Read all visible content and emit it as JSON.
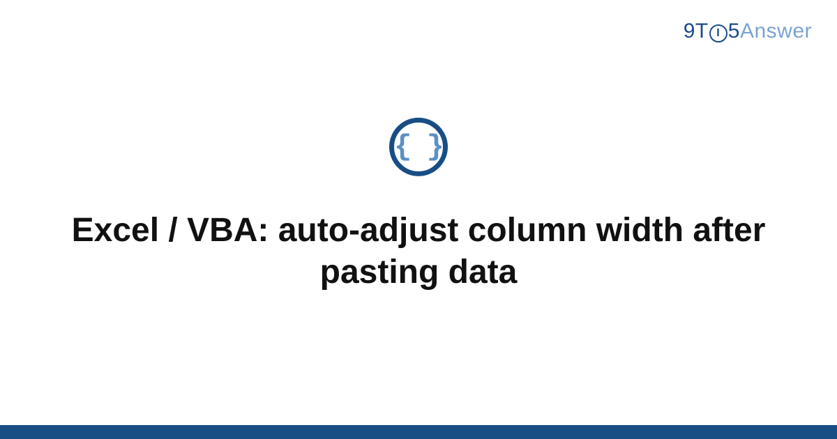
{
  "logo": {
    "part_9t": "9T",
    "part_o_inner": "I",
    "part_5": "5",
    "part_answer": "Answer"
  },
  "icon": {
    "braces": "{ }"
  },
  "title": "Excel / VBA: auto-adjust column width after pasting data",
  "colors": {
    "brand_dark": "#194e84",
    "brand_light": "#5b8fc7",
    "logo_light": "#7ba3d0"
  }
}
